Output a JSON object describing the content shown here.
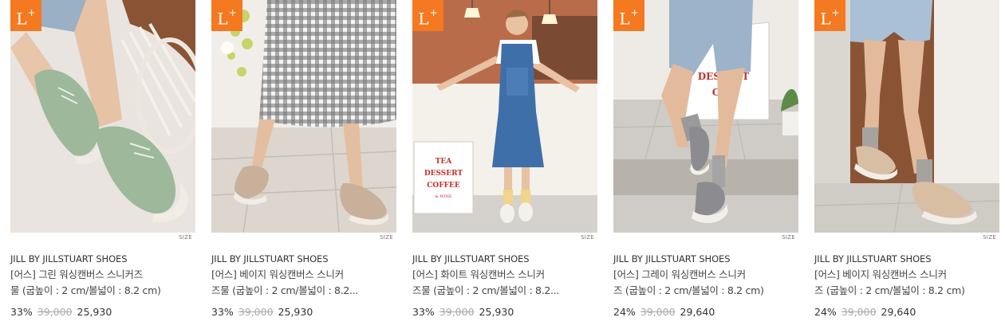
{
  "accent_color": "#f47920",
  "products": [
    {
      "badge_main": "L",
      "badge_plus": "+",
      "size_label": "SIZE",
      "brand": "JILL BY JILLSTUART SHOES",
      "title_line1": "[어스] 그린 워싱캔버스 스니커즈",
      "title_line2": "물 (굽높이 : 2 cm/볼넓이 : 8.2 cm)",
      "discount": "33%",
      "original_price": "39,000",
      "sale_price": "25,930",
      "shoe_color": "#9db89a"
    },
    {
      "badge_main": "L",
      "badge_plus": "+",
      "size_label": "SIZE",
      "brand": "JILL BY JILLSTUART SHOES",
      "title_line1": "[어스] 베이지 워싱캔버스 스니커",
      "title_line2": "즈물 (굽높이 : 2 cm/볼넓이 : 8.2...",
      "discount": "33%",
      "original_price": "39,000",
      "sale_price": "25,930",
      "shoe_color": "#c9b09a"
    },
    {
      "badge_main": "L",
      "badge_plus": "+",
      "size_label": "SIZE",
      "brand": "JILL BY JILLSTUART SHOES",
      "title_line1": "[어스] 화이트 워싱캔버스 스니커",
      "title_line2": "즈물 (굽높이 : 2 cm/볼넓이 : 8.2...",
      "discount": "33%",
      "original_price": "39,000",
      "sale_price": "25,930",
      "sign_text": [
        "TEA",
        "DESSERT",
        "COFFEE",
        "& WINE"
      ],
      "shoe_color": "#f3f1ec"
    },
    {
      "badge_main": "L",
      "badge_plus": "+",
      "size_label": "SIZE",
      "brand": "JILL BY JILLSTUART SHOES",
      "title_line1": "[어스] 그레이 워싱캔버스 스니커",
      "title_line2": "즈 (굽높이 : 2 cm/볼넓이 : 8.2 cm)",
      "discount": "24%",
      "original_price": "39,000",
      "sale_price": "29,640",
      "sign_text": [
        "T",
        "DESSERT",
        "COF"
      ],
      "shoe_color": "#8c8c90"
    },
    {
      "badge_main": "L",
      "badge_plus": "+",
      "size_label": "SIZE",
      "brand": "JILL BY JILLSTUART SHOES",
      "title_line1": "[어스] 베이지 워싱캔버스 스니커",
      "title_line2": "즈 (굽높이 : 2 cm/볼넓이 : 8.2 cm)",
      "discount": "24%",
      "original_price": "39,000",
      "sale_price": "29,640",
      "shoe_color": "#d8bfa3"
    }
  ]
}
